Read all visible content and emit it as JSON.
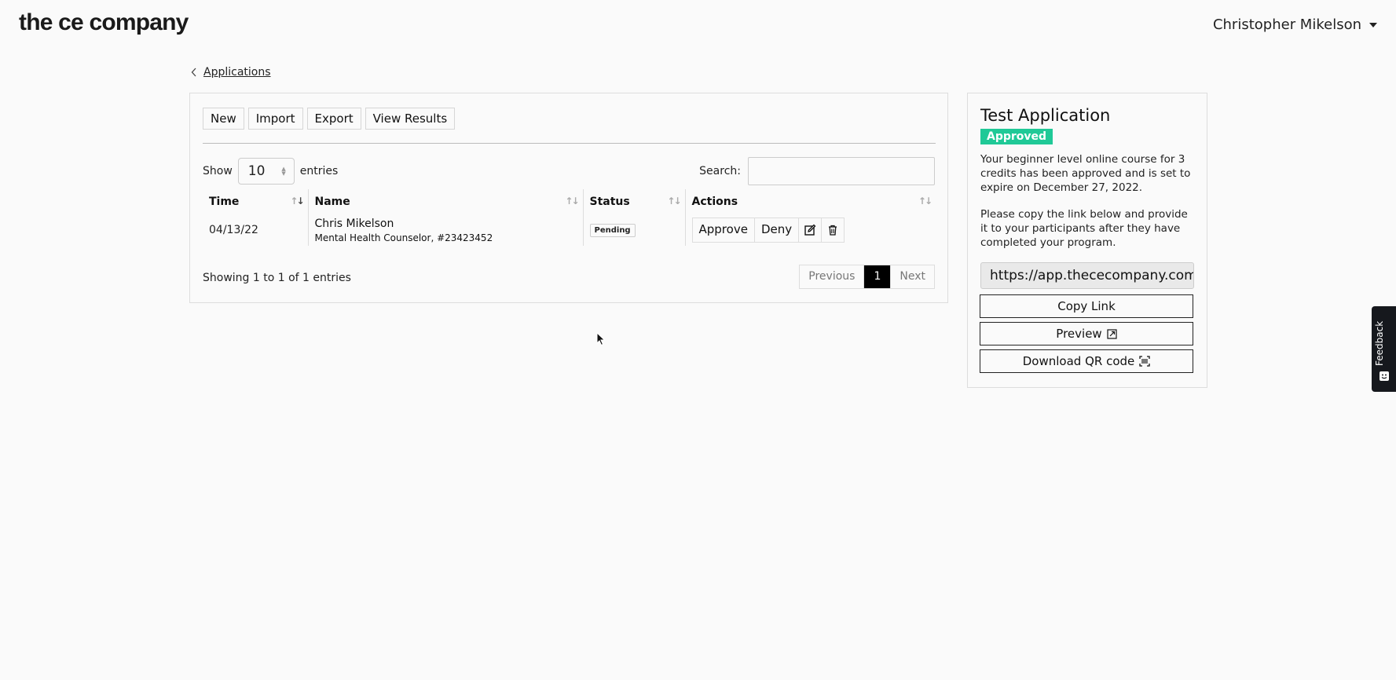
{
  "header": {
    "logo_text": "the ce company",
    "user_name": "Christopher Mikelson"
  },
  "breadcrumb": {
    "back_label": "Applications"
  },
  "toolbar": {
    "new_label": "New",
    "import_label": "Import",
    "export_label": "Export",
    "view_results_label": "View Results"
  },
  "table_controls": {
    "show_label": "Show",
    "page_length": "10",
    "entries_label": "entries",
    "search_label": "Search:",
    "search_value": ""
  },
  "table": {
    "columns": [
      "Time",
      "Name",
      "Status",
      "Actions"
    ],
    "rows": [
      {
        "time": "04/13/22",
        "name": "Chris Mikelson",
        "subtitle": "Mental Health Counselor, #23423452",
        "status": "Pending",
        "approve_label": "Approve",
        "deny_label": "Deny",
        "edit_icon": "edit-icon",
        "delete_icon": "trash-icon"
      }
    ]
  },
  "pagination": {
    "info": "Showing 1 to 1 of 1 entries",
    "previous_label": "Previous",
    "current_page": "1",
    "next_label": "Next"
  },
  "side_panel": {
    "title": "Test Application",
    "status_badge": "Approved",
    "status_color": "#20c997",
    "description": "Your beginner level online course for 3 credits has been approved and is set to expire on December 27, 2022.",
    "instructions": "Please copy the link below and provide it to your participants after they have completed your program.",
    "link_value": "https://app.thececompany.com",
    "copy_link_label": "Copy Link",
    "preview_label": "Preview",
    "preview_icon": "external-link-icon",
    "download_qr_label": "Download QR code",
    "qr_icon": "qr-code-icon"
  },
  "feedback": {
    "label": "Feedback"
  }
}
